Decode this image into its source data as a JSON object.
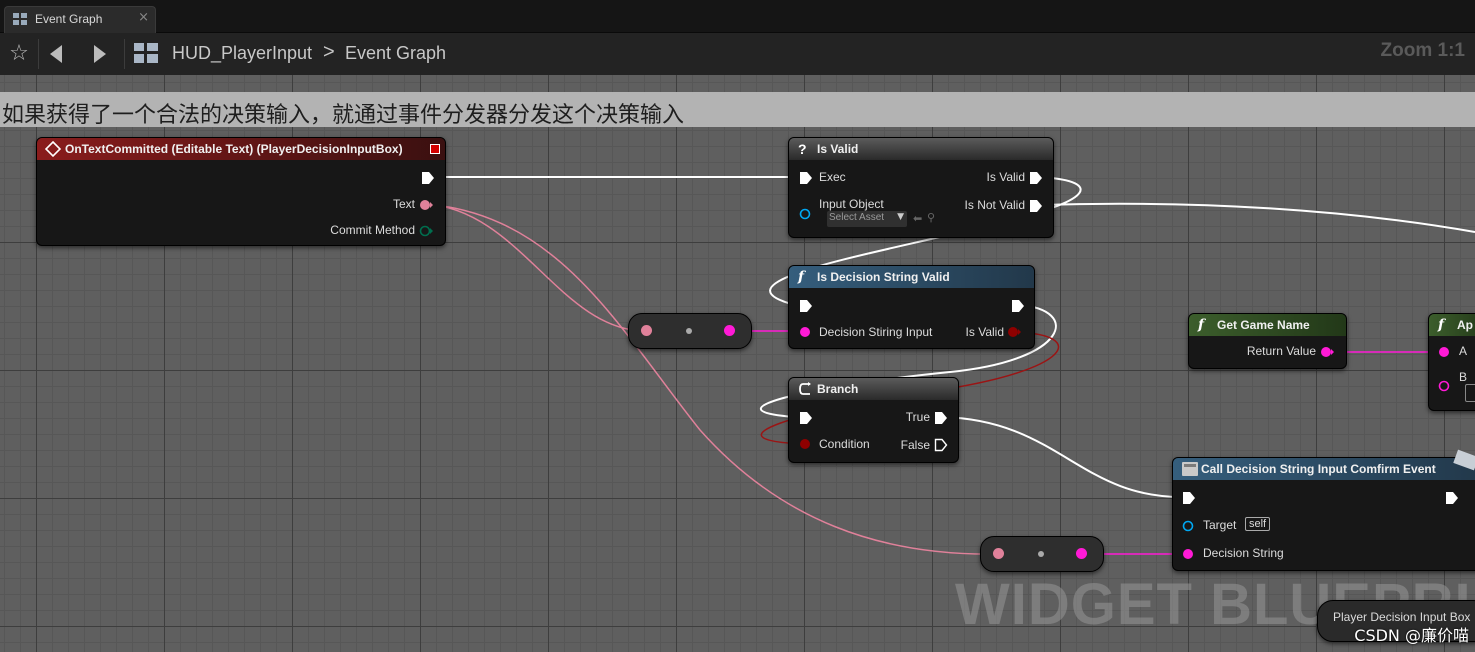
{
  "tab": {
    "title": "Event Graph",
    "close": "×"
  },
  "breadcrumb": {
    "blueprint": "HUD_PlayerInput",
    "separator": ">",
    "graph": "Event Graph"
  },
  "zoom": "Zoom 1:1",
  "comment": "如果获得了一个合法的决策输入，就通过事件分发器分发这个决策输入",
  "nodes": {
    "event": {
      "title": "OnTextCommitted (Editable Text) (PlayerDecisionInputBox)",
      "pin_text": "Text",
      "pin_commit": "Commit Method"
    },
    "is_valid": {
      "title": "Is Valid",
      "pin_exec": "Exec",
      "pin_input_object": "Input Object",
      "asset_placeholder": "Select Asset",
      "pin_is_valid": "Is Valid",
      "pin_is_not_valid": "Is Not Valid"
    },
    "is_decision": {
      "title": "Is Decision String Valid",
      "pin_input": "Decision Stiring Input",
      "pin_out": "Is Valid"
    },
    "branch": {
      "title": "Branch",
      "pin_condition": "Condition",
      "pin_true": "True",
      "pin_false": "False"
    },
    "get_game_name": {
      "title": "Get Game Name",
      "pin_return": "Return Value"
    },
    "append": {
      "title": "Ap",
      "pin_a": "A",
      "pin_b": "B"
    },
    "call_event": {
      "title": "Call Decision String Input Comfirm Event",
      "pin_target": "Target",
      "target_value": "self",
      "pin_decision": "Decision String"
    },
    "variable": {
      "label": "Player Decision Input Box"
    }
  },
  "watermark": "WIDGET BLUEPRINT",
  "credit": "CSDN @廉价喵",
  "colors": {
    "event_header": "#8a1c1c",
    "pure_header": "#355e7d",
    "func_header": "#3c5e2c",
    "string_pin": "#ff1ad6",
    "bool_pin": "#8f0000",
    "object_pin": "#00a8f3"
  }
}
